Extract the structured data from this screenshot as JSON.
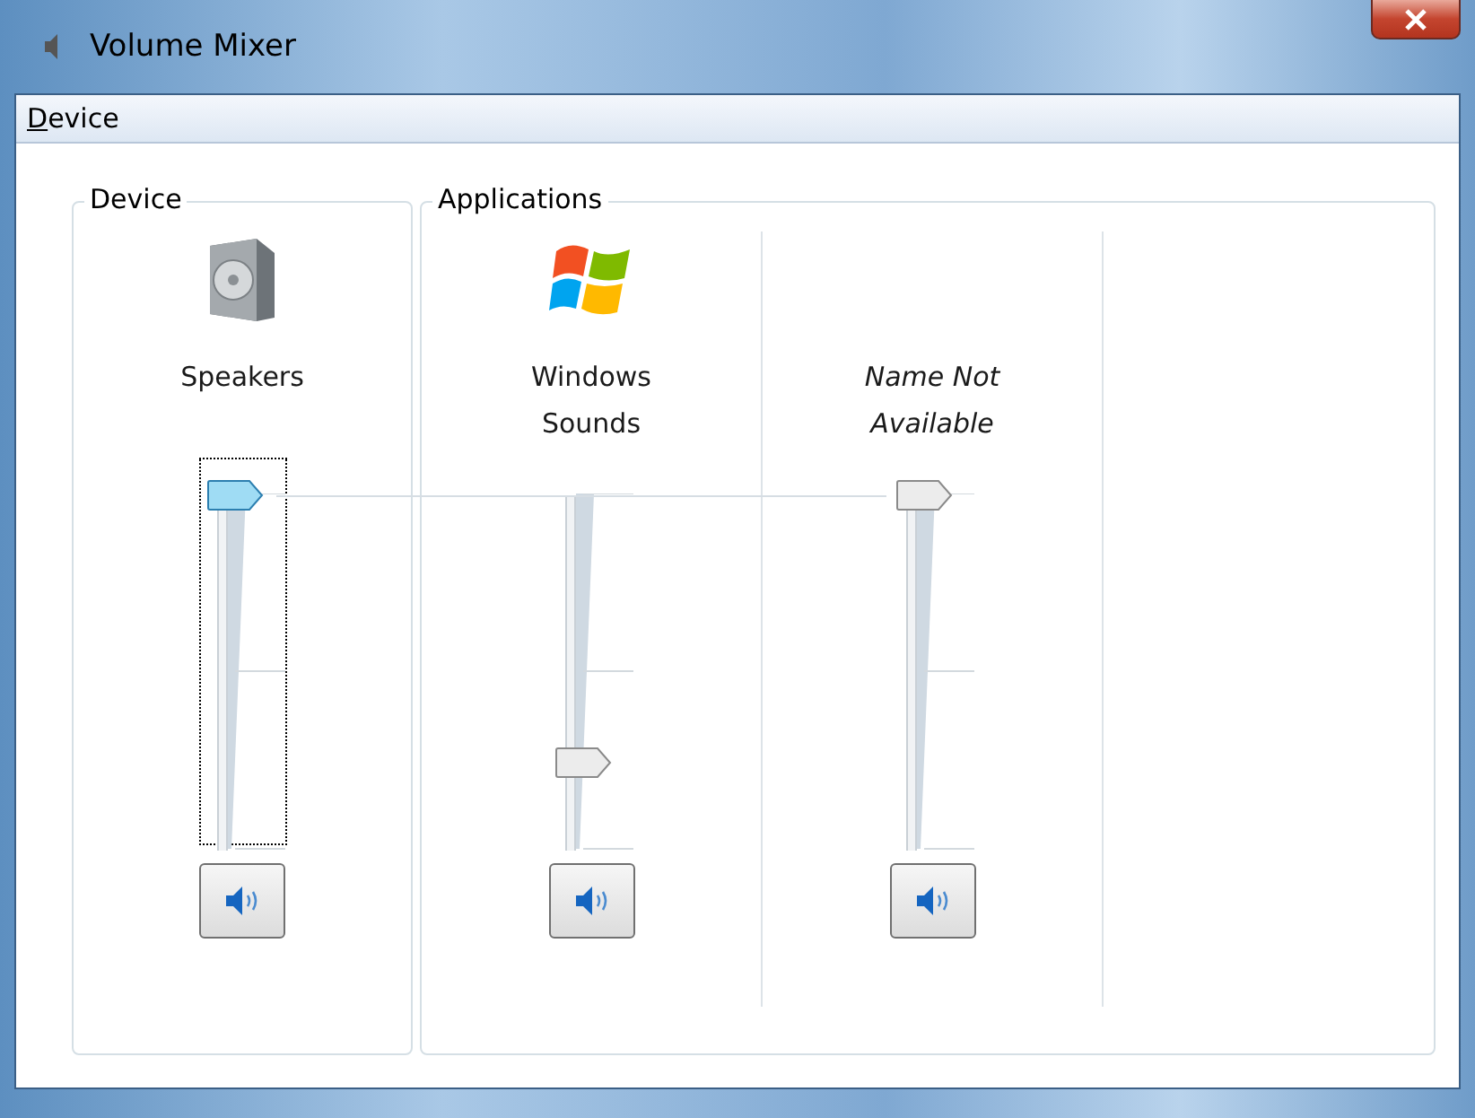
{
  "window": {
    "title": "Volume Mixer"
  },
  "menu": [
    {
      "label": "Device"
    }
  ],
  "device_group": {
    "title": "Device",
    "channels": [
      {
        "kind": "device",
        "name": "Speakers",
        "level": 1.0,
        "focused": true,
        "muted": false
      }
    ]
  },
  "applications_group": {
    "title": "Applications",
    "channels": [
      {
        "kind": "app",
        "name": "Windows Sounds",
        "level": 0.25,
        "focused": false,
        "muted": false
      },
      {
        "kind": "unnamed",
        "name": "Name Not Available",
        "level": 1.0,
        "focused": false,
        "muted": false
      }
    ]
  }
}
